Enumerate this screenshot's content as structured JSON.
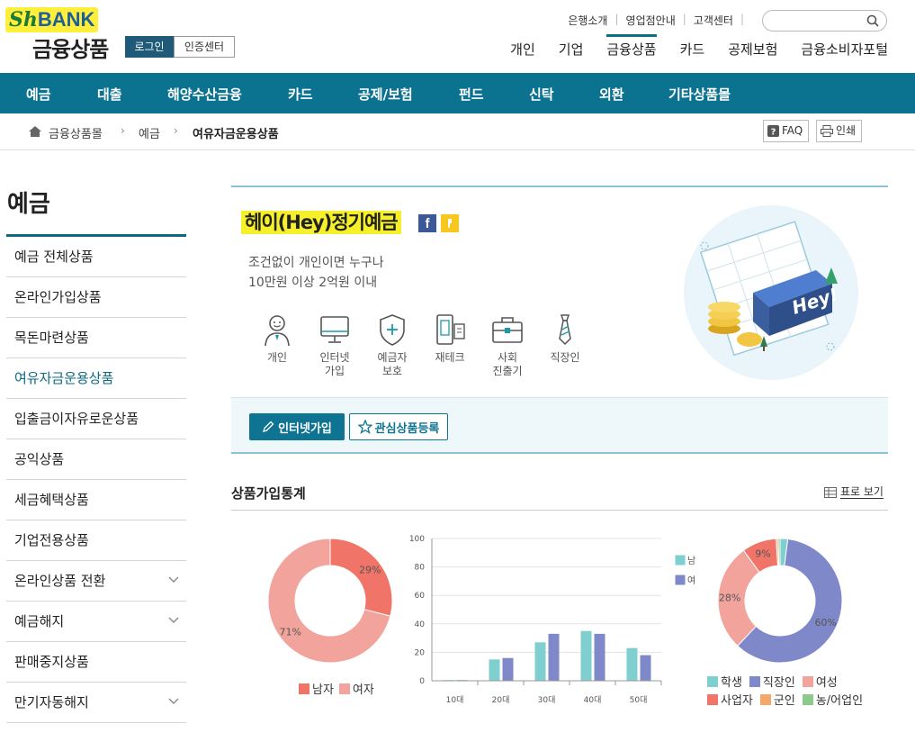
{
  "header": {
    "logo_sh": "Sh",
    "logo_bank": "BANK",
    "title": "금융상품",
    "login": "로그인",
    "cert": "인증센터",
    "util_links": [
      "은행소개",
      "영업점안내",
      "고객센터"
    ],
    "gnb": [
      "개인",
      "기업",
      "금융상품",
      "카드",
      "공제보험",
      "금융소비자포털"
    ]
  },
  "nav": [
    "예금",
    "대출",
    "해양수산금융",
    "카드",
    "공제/보험",
    "펀드",
    "신탁",
    "외환",
    "기타상품몰"
  ],
  "breadcrumb": [
    "금융상품몰",
    "예금",
    "여유자금운용상품"
  ],
  "tools": {
    "faq": "FAQ",
    "print": "인쇄"
  },
  "sidebar": {
    "title": "예금",
    "items": [
      {
        "label": "예금 전체상품"
      },
      {
        "label": "온라인가입상품"
      },
      {
        "label": "목돈마련상품"
      },
      {
        "label": "여유자금운용상품"
      },
      {
        "label": "입출금이자유로운상품"
      },
      {
        "label": "공익상품"
      },
      {
        "label": "세금혜택상품"
      },
      {
        "label": "기업전용상품"
      },
      {
        "label": "온라인상품 전환"
      },
      {
        "label": "예금해지"
      },
      {
        "label": "판매중지상품"
      },
      {
        "label": "만기자동해지"
      }
    ]
  },
  "product": {
    "name": "헤이(Hey)정기예금",
    "desc1": "조건없이 개인이면 누구나",
    "desc2": "10만원 이상 2억원 이내",
    "features": [
      "개인",
      "인터넷\n가입",
      "예금자\n보호",
      "재테크",
      "사회\n진출기",
      "직장인"
    ],
    "illust_text": "Hey!",
    "join_btn": "인터넷가입",
    "fav_btn": "관심상품등록"
  },
  "stats": {
    "title": "상품가입통계",
    "table_view": "표로 보기"
  },
  "colors": {
    "accent": "#0b7390",
    "male": "#f07467",
    "female": "#f2a49c",
    "bar_male": "#7fcfd0",
    "bar_female": "#7f88c8",
    "student": "#7fcfd0",
    "worker": "#7f88c8",
    "housewife": "#f2a49c",
    "business": "#f07467",
    "soldier": "#f5a86a",
    "farmer": "#8cc98c"
  },
  "chart_data": [
    {
      "type": "pie",
      "labels": [
        "남자",
        "여자"
      ],
      "values": [
        29,
        71
      ],
      "data_labels": [
        "29%",
        "71%"
      ]
    },
    {
      "type": "bar",
      "categories": [
        "10대",
        "20대",
        "30대",
        "40대",
        "50대"
      ],
      "series": [
        {
          "name": "남",
          "values": [
            0.5,
            15,
            27,
            35,
            23
          ]
        },
        {
          "name": "여",
          "values": [
            0.5,
            16,
            33,
            33,
            18
          ]
        }
      ],
      "ylim": [
        0,
        100
      ],
      "yticks": [
        0,
        20,
        40,
        60,
        80,
        100
      ],
      "grid": true,
      "legend": "right"
    },
    {
      "type": "pie",
      "labels": [
        "학생",
        "직장인",
        "여성",
        "사업자",
        "군인",
        "농/어업인"
      ],
      "values": [
        2,
        60,
        28,
        9,
        0.5,
        0.5
      ],
      "data_labels": [
        "",
        "60%",
        "28%",
        "9%",
        "",
        ""
      ]
    }
  ]
}
